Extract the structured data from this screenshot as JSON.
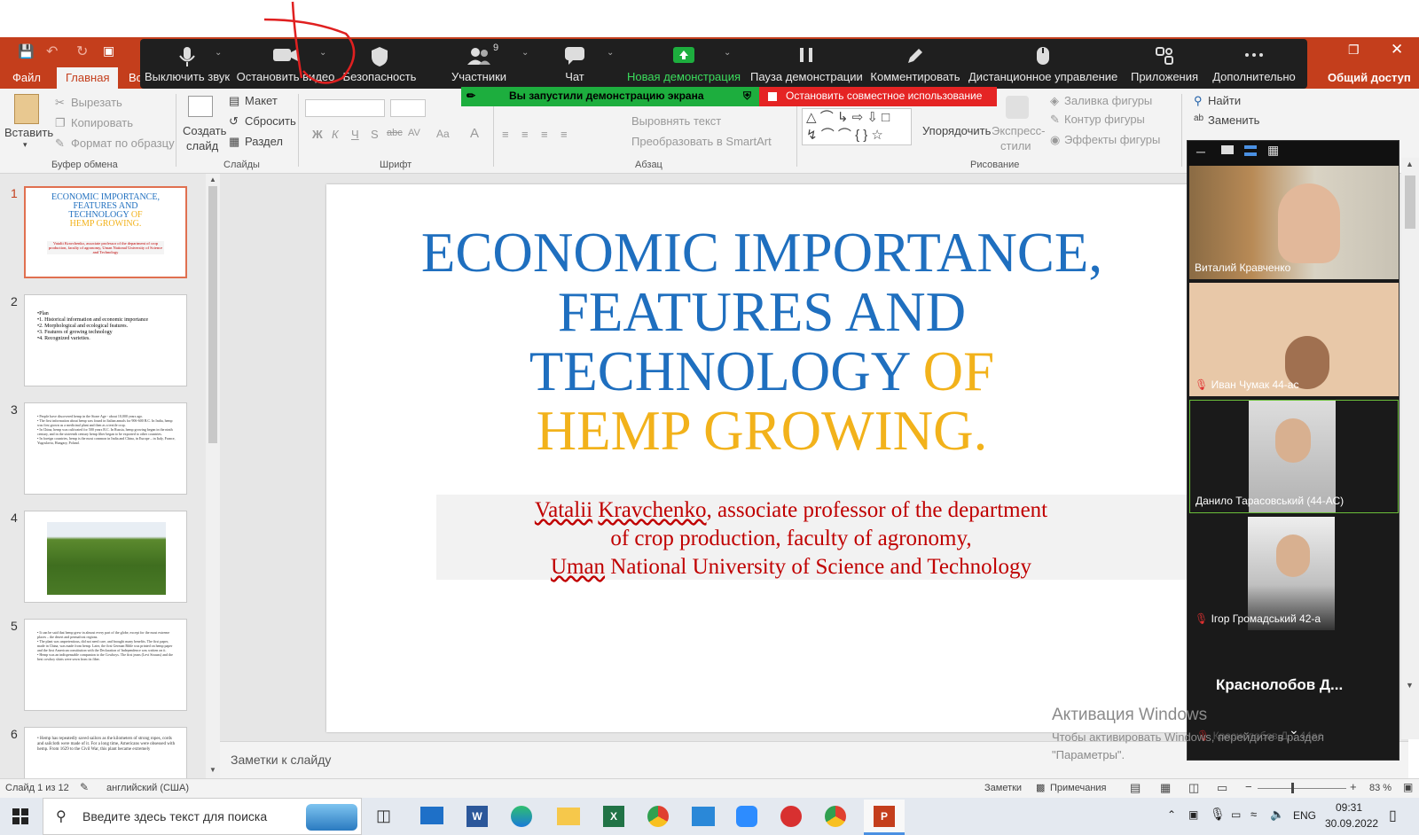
{
  "ppt": {
    "file_tab": "Файл",
    "active_tab": "Главная",
    "partial_tab": "Вс",
    "share_button": "Общий доступ",
    "clipboard": {
      "paste": "Вставить",
      "cut": "Вырезать",
      "copy": "Копировать",
      "format_painter": "Формат по образцу",
      "group": "Буфер обмена"
    },
    "slides_group": {
      "new_slide": "Создать",
      "new_slide2": "слайд",
      "layout": "Макет",
      "reset": "Сбросить",
      "section": "Раздел",
      "group": "Слайды"
    },
    "font_group": {
      "group": "Шрифт",
      "bold": "Ж",
      "italic": "К",
      "underline": "Ч",
      "strike": "S",
      "abc": "abc",
      "spacing": "AV",
      "case": "Aa",
      "color": "A"
    },
    "paragraph_group": {
      "align_text": "Выровнять текст",
      "smartart": "Преобразовать в SmartArt",
      "group": "Абзац"
    },
    "drawing_group": {
      "arrange": "Упорядочить",
      "quick_styles": "Экспресс-",
      "quick_styles2": "стили",
      "fill": "Заливка фигуры",
      "outline": "Контур фигуры",
      "effects": "Эффекты фигуры",
      "group": "Рисование"
    },
    "editing_group": {
      "find": "Найти",
      "replace": "Заменить"
    },
    "notes_placeholder": "Заметки к слайду",
    "status": {
      "slide_of": "Слайд 1 из 12",
      "language": "английский (США)",
      "notes": "Заметки",
      "comments": "Примечания",
      "zoom": "83 %"
    }
  },
  "zoom_toolbar": {
    "items": [
      {
        "label": "Выключить звук",
        "icon": "microphone-icon"
      },
      {
        "label": "Остановить видео",
        "icon": "camera-icon"
      },
      {
        "label": "Безопасность",
        "icon": "shield-icon"
      },
      {
        "label": "Участники",
        "icon": "participants-icon",
        "count": "9"
      },
      {
        "label": "Чат",
        "icon": "chat-icon"
      },
      {
        "label": "Новая демонстрация",
        "icon": "share-screen-icon"
      },
      {
        "label": "Пауза демонстрации",
        "icon": "pause-icon"
      },
      {
        "label": "Комментировать",
        "icon": "pen-icon"
      },
      {
        "label": "Дистанционное управление",
        "icon": "mouse-icon"
      },
      {
        "label": "Приложения",
        "icon": "apps-icon"
      },
      {
        "label": "Дополнительно",
        "icon": "more-icon"
      }
    ],
    "sharing_notice": "Вы запустили демонстрацию экрана",
    "stop_sharing": "Остановить совместное использование"
  },
  "slide": {
    "title_line1": "ECONOMIC IMPORTANCE,",
    "title_line2": "FEATURES AND",
    "title_line3a": "TECHNOLOGY",
    "title_line3b": "OF",
    "title_line4": "HEMP GROWING.",
    "subtitle_line1_a": "Vatalii",
    "subtitle_line1_b": "Kravchenko",
    "subtitle_line1_c": ", associate professor of the department",
    "subtitle_line2": "of crop production, faculty of agronomy,",
    "subtitle_line3_a": "Uman",
    "subtitle_line3_b": " National University of Science and Technology",
    "colors": {
      "blue": "#1f6fbf",
      "gold": "#f2b21b",
      "red": "#c00000"
    }
  },
  "thumbnails": [
    {
      "num": "1",
      "title_a": "ECONOMIC IMPORTANCE,",
      "title_b": "FEATURES AND",
      "title_c": "TECHNOLOGY",
      "title_d": "OF",
      "title_e": "HEMP GROWING.",
      "sub": "Vatalii Kravchenko, associate professor of the department of crop production, faculty of agronomy, Uman National University of Science and Technology"
    },
    {
      "num": "2",
      "lines": [
        "•Plan",
        "•1. Historical information and economic importance",
        "•2. Morphological and ecological features.",
        "•3. Features of growing technology",
        "•4. Recognized varieties."
      ]
    },
    {
      "num": "3",
      "lines": [
        "• People have discovered hemp in the Stone Age - about 10,000 years ago.",
        "• The first information about hemp was found in Italian annals for 906-600 B.C. In India, hemp was first grown as a medicinal plant and then as a textile crop.",
        "• In China, hemp was cultivated for 500 years B.C. In Russia, hemp growing began in the ninth century, and in the sixteenth century hemp fiber began to be exported to other countries.",
        "• In foreign countries, hemp is the most common in India and China, in Europe – in Italy, France, Yugoslavia, Hungary, Poland."
      ]
    },
    {
      "num": "4"
    },
    {
      "num": "5",
      "lines": [
        "• It can be said that hemp grew in almost every part of the globe, except for the most extreme places – the desert and permafrost regions.",
        "• The plant was unpretentious, did not need care, and brought many benefits. The first paper, made in China, was made from hemp. Later, the first German Bible was printed on hemp paper and the first American constitution with the Declaration of Independence was written on it.",
        "• Hemp was an indispensable companion to the Cowboys. The first jeans (Levi Strauss) and the best cowboy shirts were sewn from its fiber."
      ]
    },
    {
      "num": "6",
      "lines": [
        "• Hemp has repeatedly saved sailors as the kilometers of strong ropes, cords and sailcloth were made of it. For a long time, Americans were obsessed with hemp. From 1629 to the Civil War, this plant became extremely"
      ]
    }
  ],
  "participants": [
    {
      "name": "Виталий Кравченко",
      "muted": false
    },
    {
      "name": "Иван Чумак 44-ас",
      "muted": true
    },
    {
      "name": "Данило Тарасовський (44-АС)",
      "muted": false
    },
    {
      "name": "Ігор Громадський 42-а",
      "muted": true
    },
    {
      "name": "Краснолобов  Д...",
      "muted": false
    },
    {
      "name": "Краснолобов Д... 44ас",
      "muted": true
    }
  ],
  "activation": {
    "title": "Активация Windows",
    "line1": "Чтобы активировать Windows, перейдите в раздел",
    "line2": "\"Параметры\"."
  },
  "taskbar": {
    "search_placeholder": "Введите здесь текст для поиска",
    "lang": "ENG",
    "time": "09:31",
    "date": "30.09.2022"
  }
}
